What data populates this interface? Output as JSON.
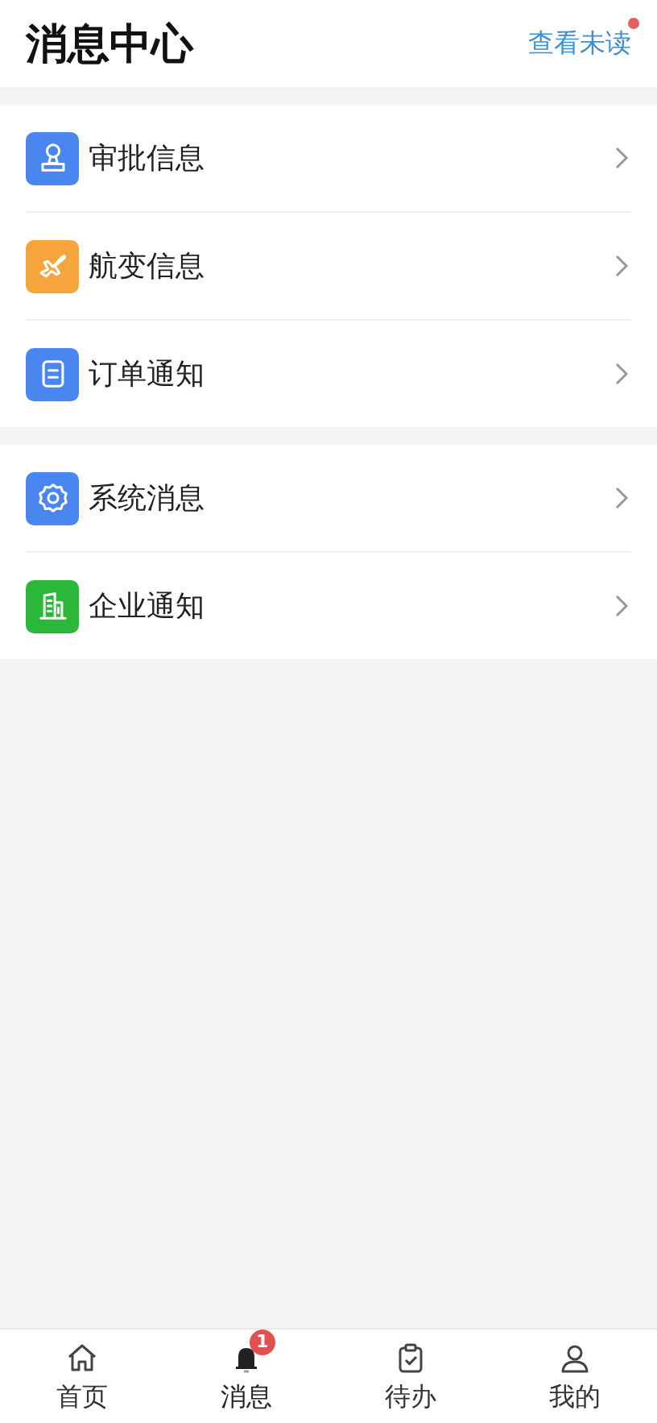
{
  "header": {
    "title": "消息中心",
    "action": {
      "label": "查看未读",
      "has_unread": true
    }
  },
  "groups": [
    {
      "items": [
        {
          "label": "审批信息",
          "kind": "stamp",
          "color": "#4a86f0"
        },
        {
          "label": "航变信息",
          "kind": "plane",
          "color": "#f6a43c"
        },
        {
          "label": "订单通知",
          "kind": "document",
          "color": "#4a86f0"
        }
      ]
    },
    {
      "items": [
        {
          "label": "系统消息",
          "kind": "gear",
          "color": "#4a86f0"
        },
        {
          "label": "企业通知",
          "kind": "building",
          "color": "#2bb83a"
        }
      ]
    }
  ],
  "tab_bar": [
    {
      "label": "首页",
      "kind": "home",
      "selected": false
    },
    {
      "label": "消息",
      "kind": "bell",
      "selected": true,
      "badge": "1"
    },
    {
      "label": "待办",
      "kind": "clipboard",
      "selected": false
    },
    {
      "label": "我的",
      "kind": "person",
      "selected": false
    }
  ]
}
